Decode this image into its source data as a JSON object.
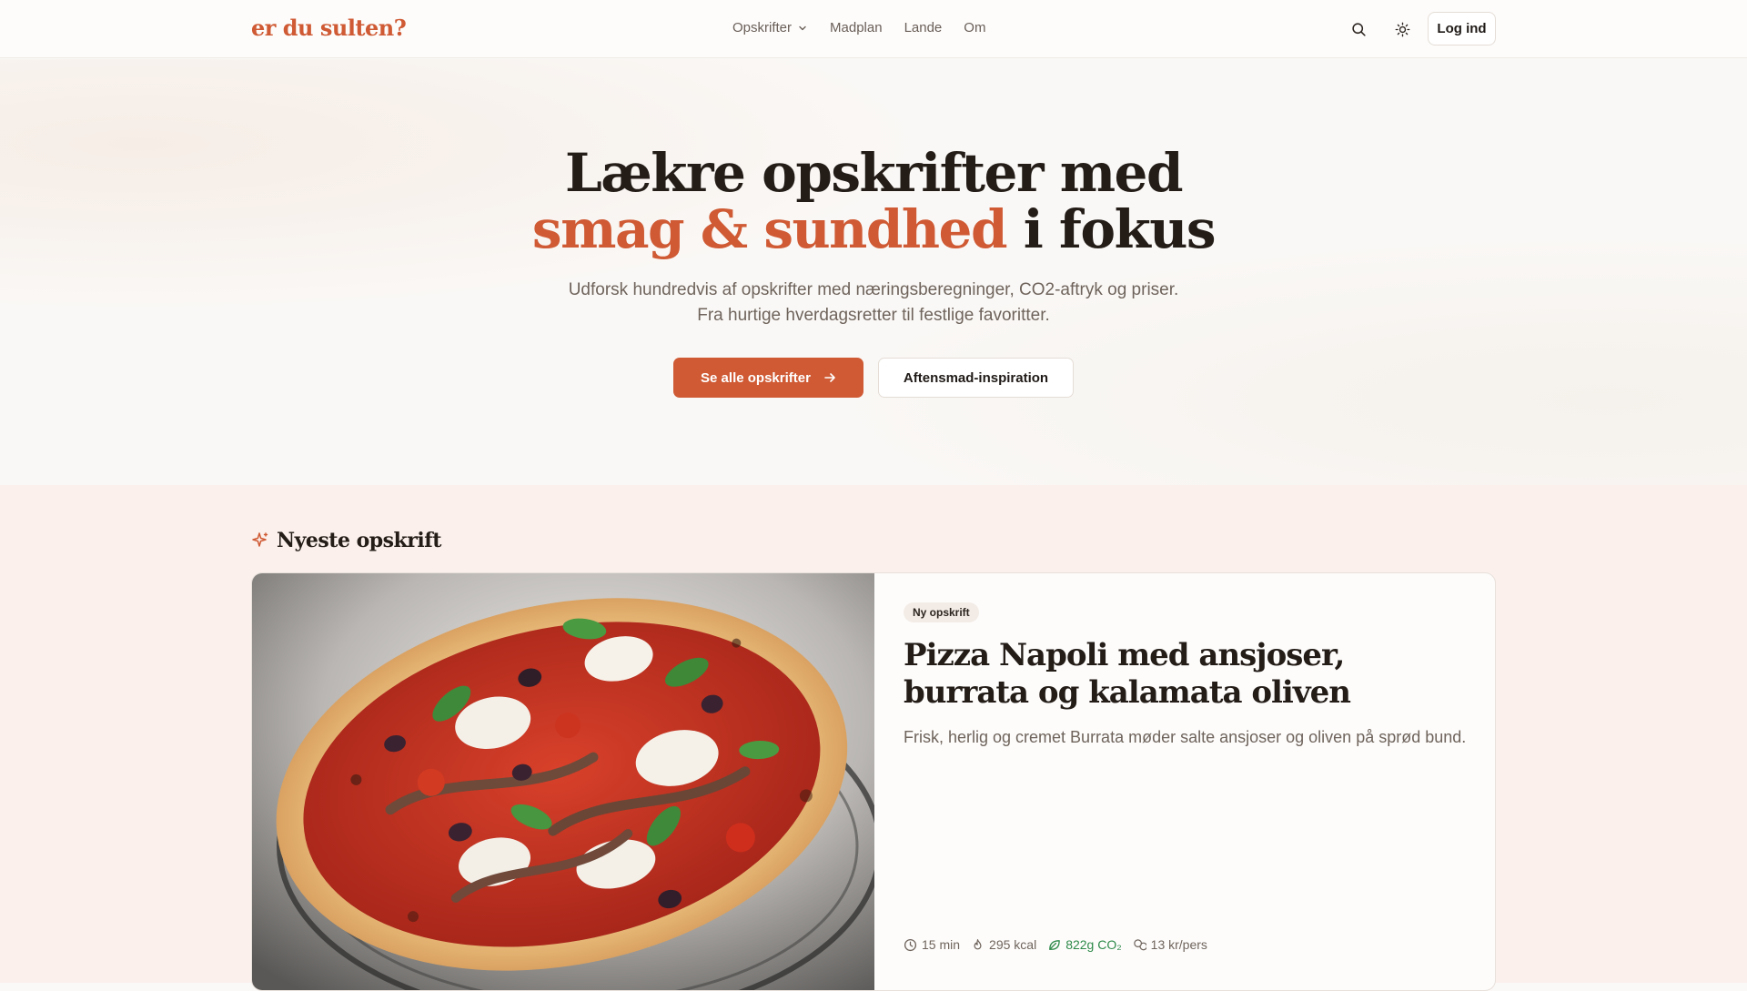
{
  "header": {
    "logo": "er du sulten?",
    "nav": [
      {
        "label": "Opskrifter",
        "has_dropdown": true
      },
      {
        "label": "Madplan"
      },
      {
        "label": "Lande"
      },
      {
        "label": "Om"
      }
    ],
    "icons": [
      "search-icon",
      "sun-icon"
    ],
    "login_label": "Log ind"
  },
  "hero": {
    "title_line1": "Lækre opskrifter med",
    "title_accent": "smag & sundhed",
    "title_rest": " i fokus",
    "subtitle_line1": "Udforsk hundredvis af opskrifter med næringsberegninger, CO2-aftryk og priser.",
    "subtitle_line2": "Fra hurtige hverdagsretter til festlige favoritter.",
    "primary_button": "Se alle opskrifter",
    "secondary_button": "Aftensmad-inspiration"
  },
  "latest": {
    "heading": "Nyeste opskrift",
    "badge": "Ny opskrift",
    "title": "Pizza Napoli med ansjoser, burrata og kalamata oliven",
    "description": "Frisk, herlig og cremet Burrata møder salte ansjoser og oliven på sprød bund.",
    "meta": {
      "time": "15 min",
      "kcal": "295 kcal",
      "co2": "822g CO₂",
      "price": "13 kr/pers"
    },
    "image": "pizza-photo"
  },
  "colors": {
    "accent": "#cf5a34",
    "text": "#231c17",
    "muted": "#6f645c",
    "co2_green": "#2f8a4a",
    "section_bg": "#fbf0ec"
  }
}
